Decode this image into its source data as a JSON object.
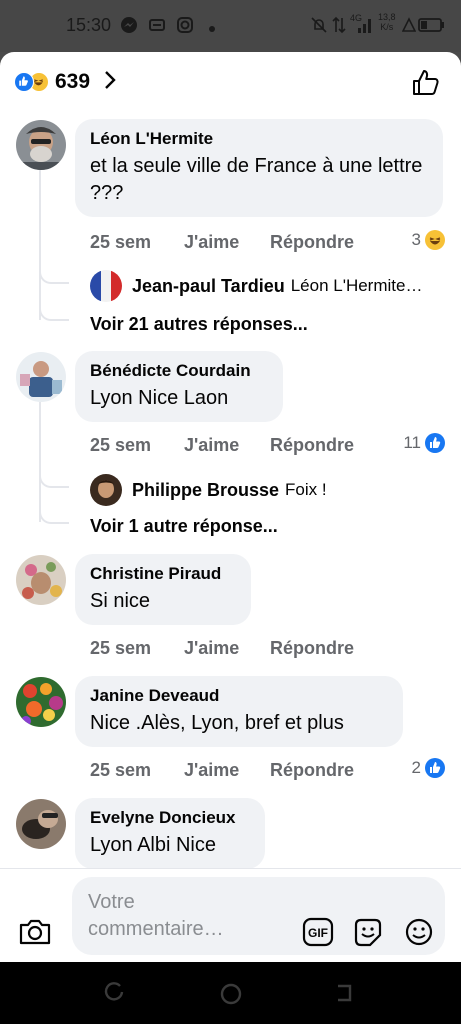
{
  "status_bar": {
    "time": "15:30",
    "network": "4G",
    "speed_top": "13,8",
    "speed_bottom": "K/s"
  },
  "header": {
    "reaction_count": "639"
  },
  "comments": [
    {
      "author": "Léon L'Hermite",
      "text": "et la seule ville de France à une lettre ???",
      "time": "25 sem",
      "like_label": "J'aime",
      "reply_label": "Répondre",
      "reaction_count": "3",
      "reaction_type": "haha-icon",
      "reply_preview": {
        "author": "Jean-paul Tardieu",
        "text": "Léon L'Hermite…"
      },
      "more_replies": "Voir 21 autres réponses..."
    },
    {
      "author": "Bénédicte Courdain",
      "text": "Lyon Nice Laon",
      "time": "25 sem",
      "like_label": "J'aime",
      "reply_label": "Répondre",
      "reaction_count": "11",
      "reaction_type": "like-icon",
      "reply_preview": {
        "author": "Philippe Brousse",
        "text": "Foix !"
      },
      "more_replies": "Voir 1 autre réponse..."
    },
    {
      "author": "Christine Piraud",
      "text": "Si nice",
      "time": "25 sem",
      "like_label": "J'aime",
      "reply_label": "Répondre"
    },
    {
      "author": "Janine Deveaud",
      "text": "Nice .Alès, Lyon, bref et plus",
      "time": "25 sem",
      "like_label": "J'aime",
      "reply_label": "Répondre",
      "reaction_count": "2",
      "reaction_type": "like-icon"
    },
    {
      "author": "Evelyne Doncieux",
      "text": "Lyon Albi Nice"
    }
  ],
  "composer": {
    "placeholder": "Votre commentaire…",
    "gif_label": "GIF"
  },
  "colors": {
    "like_blue": "#1877f2",
    "haha_yellow": "#f7c136",
    "bubble_gray": "#f0f2f5",
    "meta_gray": "#65676b"
  }
}
